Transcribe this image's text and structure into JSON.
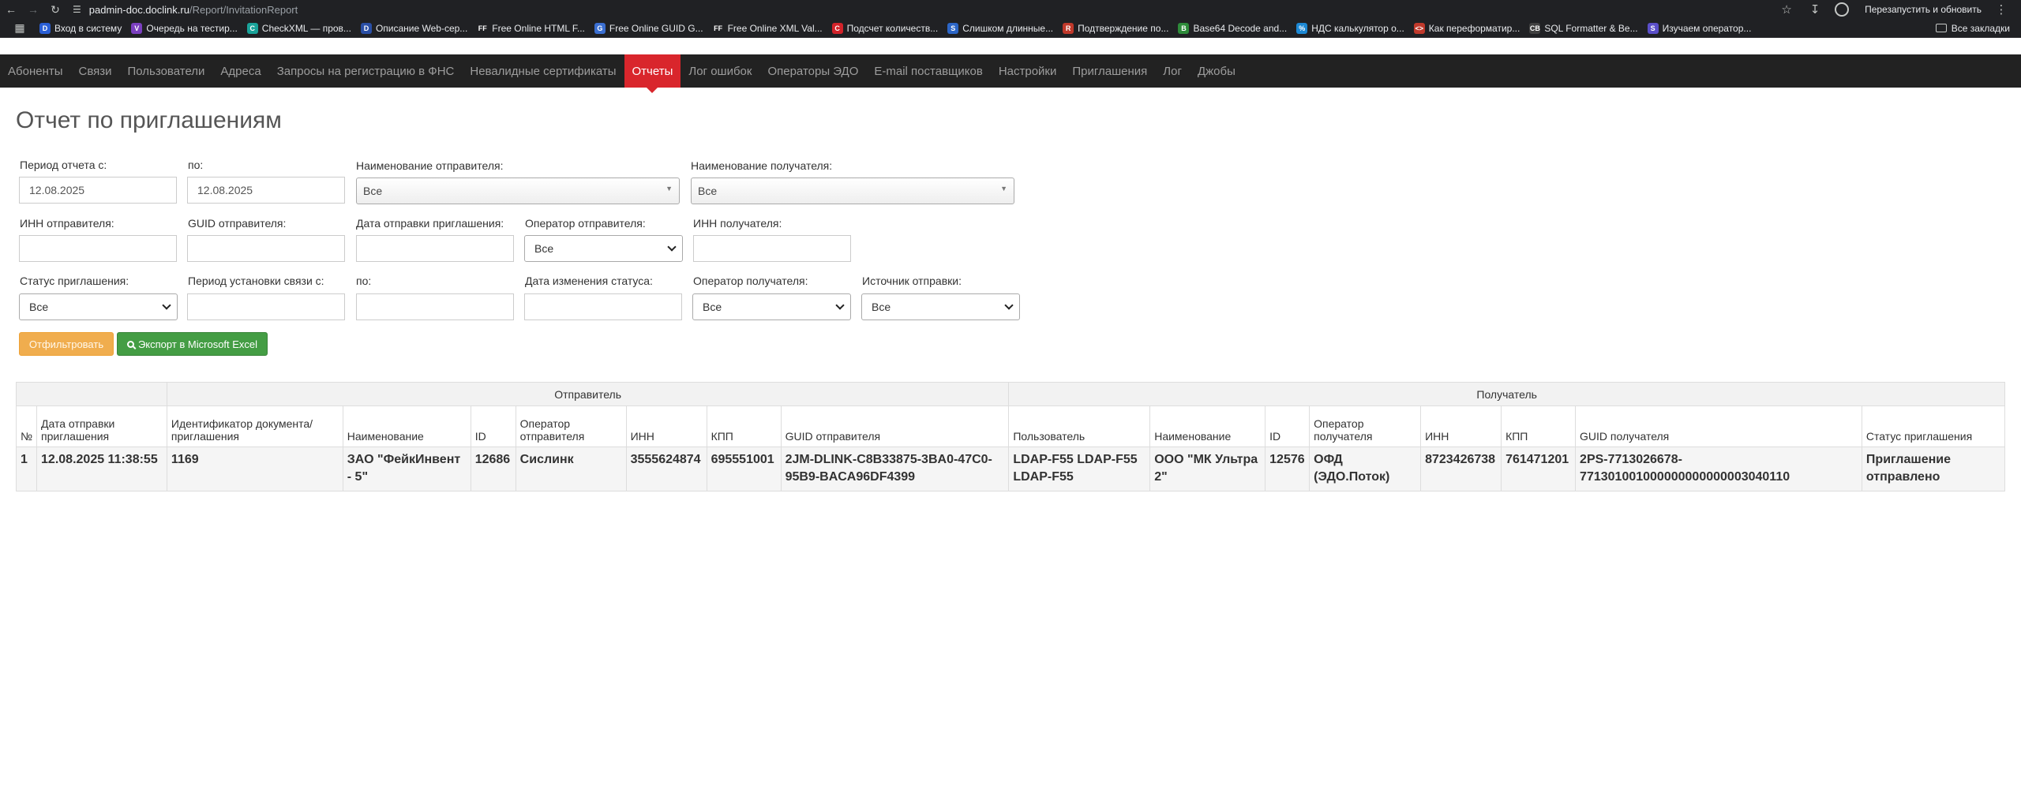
{
  "browser": {
    "url_host": "padmin-doc.doclink.ru",
    "url_path": "/Report/InvitationReport",
    "relaunch": "Перезапустить и обновить",
    "bookmarks": [
      {
        "label": "Вход в систему",
        "fav": "D",
        "color": "#2a5fd6"
      },
      {
        "label": "Очередь на тестир...",
        "fav": "V",
        "color": "#7b3fbf"
      },
      {
        "label": "CheckXML — пров...",
        "fav": "C",
        "color": "#1aa39a"
      },
      {
        "label": "Описание Web-сер...",
        "fav": "D",
        "color": "#2a4fa6"
      },
      {
        "label": "Free Online HTML F...",
        "fav": "FF",
        "color": "#202124"
      },
      {
        "label": "Free Online GUID G...",
        "fav": "G",
        "color": "#3b6fd1"
      },
      {
        "label": "Free Online XML Val...",
        "fav": "FF",
        "color": "#202124"
      },
      {
        "label": "Подсчет количеств...",
        "fav": "C",
        "color": "#d2232a"
      },
      {
        "label": "Слишком длинные...",
        "fav": "S",
        "color": "#2c66c7"
      },
      {
        "label": "Подтверждение по...",
        "fav": "R",
        "color": "#c0392b"
      },
      {
        "label": "Base64 Decode and...",
        "fav": "B",
        "color": "#2e8b3a"
      },
      {
        "label": "НДС калькулятор о...",
        "fav": "%",
        "color": "#1c88d4"
      },
      {
        "label": "Как переформатир...",
        "fav": "<>",
        "color": "#c0392b"
      },
      {
        "label": "SQL Formatter & Be...",
        "fav": "CB",
        "color": "#404040"
      },
      {
        "label": "Изучаем оператор...",
        "fav": "S",
        "color": "#5b4fc9"
      }
    ],
    "all_bookmarks": "Все закладки"
  },
  "nav": {
    "items": [
      "Абоненты",
      "Связи",
      "Пользователи",
      "Адреса",
      "Запросы на регистрацию в ФНС",
      "Невалидные сертификаты",
      "Отчеты",
      "Лог ошибок",
      "Операторы ЭДО",
      "E-mail поставщиков",
      "Настройки",
      "Приглашения",
      "Лог",
      "Джобы"
    ],
    "active": "Отчеты"
  },
  "page": {
    "title": "Отчет по приглашениям"
  },
  "filters": {
    "period_from_label": "Период отчета с:",
    "period_from_value": "12.08.2025",
    "period_to_label": "по:",
    "period_to_value": "12.08.2025",
    "sender_name_label": "Наименование отправителя:",
    "sender_name_value": "Все",
    "recipient_name_label": "Наименование получателя:",
    "recipient_name_value": "Все",
    "sender_inn_label": "ИНН отправителя:",
    "sender_guid_label": "GUID отправителя:",
    "send_date_label": "Дата отправки приглашения:",
    "sender_operator_label": "Оператор отправителя:",
    "sender_operator_value": "Все",
    "recipient_inn_label": "ИНН получателя:",
    "status_label": "Статус приглашения:",
    "status_value": "Все",
    "link_period_label": "Период установки связи с:",
    "link_period_to_label": "по:",
    "status_change_label": "Дата изменения статуса:",
    "recipient_operator_label": "Оператор получателя:",
    "recipient_operator_value": "Все",
    "source_label": "Источник отправки:",
    "source_value": "Все"
  },
  "buttons": {
    "filter": "Отфильтровать",
    "export": "Экспорт в Microsoft Excel"
  },
  "table": {
    "group_sender": "Отправитель",
    "group_recipient": "Получатель",
    "columns": [
      "№",
      "Дата отправки приглашения",
      "Идентификатор документа/ приглашения",
      "Наименование",
      "ID",
      "Оператор отправителя",
      "ИНН",
      "КПП",
      "GUID отправителя",
      "Пользователь",
      "Наименование",
      "ID",
      "Оператор получателя",
      "ИНН",
      "КПП",
      "GUID получателя",
      "Статус приглашения"
    ],
    "rows": [
      [
        "1",
        "12.08.2025 11:38:55",
        "1169",
        "ЗАО \"ФейкИнвент - 5\"",
        "12686",
        "Сислинк",
        "3555624874",
        "695551001",
        "2JM-DLINK-C8B33875-3BA0-47C0-95B9-BACA96DF4399",
        "LDAP-F55 LDAP-F55 LDAP-F55",
        "ООО \"МК Ультра 2\"",
        "12576",
        "ОФД (ЭДО.Поток)",
        "8723426738",
        "761471201",
        "2PS-7713026678-771301001000000000000003040110",
        "Приглашение отправлено"
      ]
    ]
  }
}
